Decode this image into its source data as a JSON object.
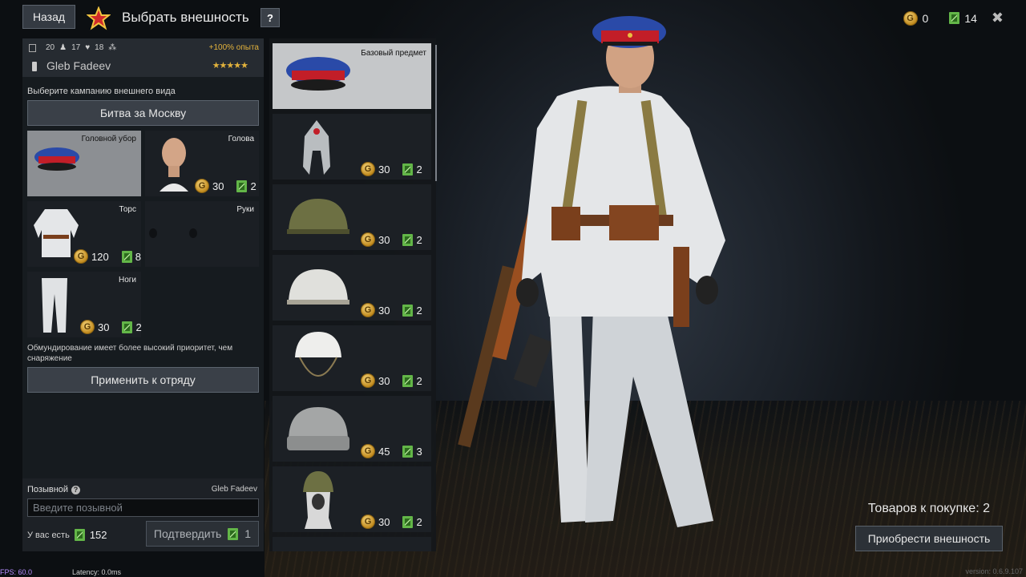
{
  "header": {
    "back_label": "Назад",
    "title": "Выбрать внешность",
    "help_label": "?",
    "gold": "0",
    "tickets": "14"
  },
  "player": {
    "stat1": "20",
    "stat2": "17",
    "stat3": "18",
    "xp_bonus": "+100% опыта",
    "name": "Gleb Fadeev",
    "rank_stars": "★★★★★"
  },
  "campaign": {
    "label": "Выберите кампанию внешнего вида",
    "selected": "Битва за Москву"
  },
  "slots": [
    {
      "label": "Головной убор"
    },
    {
      "label": "Голова",
      "gold": "30",
      "tickets": "2"
    },
    {
      "label": "Торс",
      "gold": "120",
      "tickets": "8"
    },
    {
      "label": "Руки"
    },
    {
      "label": "Ноги",
      "gold": "30",
      "tickets": "2"
    }
  ],
  "priority_note": "Обмундирование имеет более высокий приоритет, чем снаряжение",
  "apply_label": "Применить к отряду",
  "callsign": {
    "label": "Позывной",
    "current": "Gleb Fadeev",
    "placeholder": "Введите позывной",
    "have_label": "У вас есть",
    "have_tickets": "152",
    "confirm_label": "Подтвердить",
    "confirm_cost": "1"
  },
  "items": [
    {
      "label": "Базовый предмет"
    },
    {
      "gold": "30",
      "tickets": "2"
    },
    {
      "gold": "30",
      "tickets": "2"
    },
    {
      "gold": "30",
      "tickets": "2"
    },
    {
      "gold": "30",
      "tickets": "2"
    },
    {
      "gold": "45",
      "tickets": "3"
    },
    {
      "gold": "30",
      "tickets": "2"
    }
  ],
  "cart": {
    "count_text": "Товаров к покупке: 2",
    "buy_label": "Приобрести внешность"
  },
  "footer": {
    "fps": "FPS: 60.0",
    "latency": "Latency: 0.0ms",
    "version": "version: 0.6.9.107"
  }
}
